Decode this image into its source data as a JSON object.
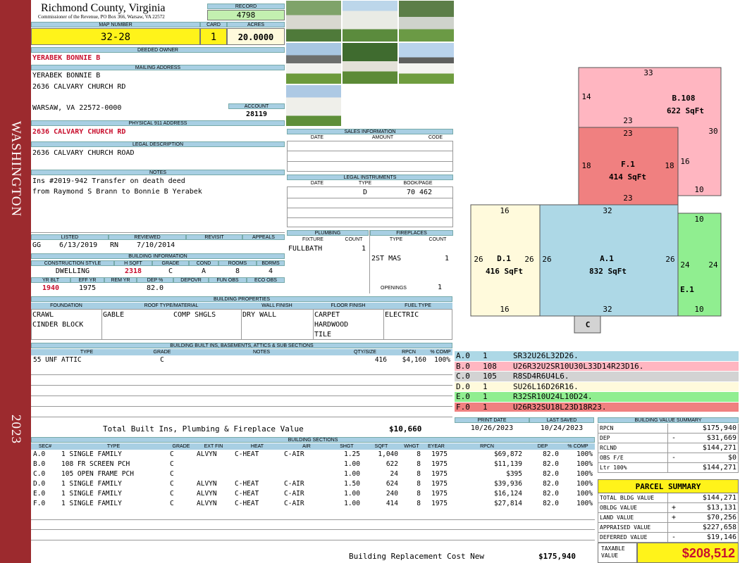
{
  "side": {
    "district": "WASHINGTON",
    "year": "2023"
  },
  "header": {
    "county": "Richmond County, Virginia",
    "commissioner": "Commissioner of the Revenue, PO Box 366, Warsaw, VA 22572",
    "record_label": "RECORD",
    "record": "4798"
  },
  "ids": {
    "map_label": "MAP NUMBER",
    "map": "32-28",
    "card_label": "CARD",
    "card": "1",
    "acres_label": "ACRES",
    "acres": "20.0000"
  },
  "owner": {
    "label": "DEEDED OWNER",
    "name": "YERABEK BONNIE B"
  },
  "mailing": {
    "label": "MAILING ADDRESS",
    "line1": "YERABEK BONNIE B",
    "line2": "2636 CALVARY CHURCH RD",
    "line3": "WARSAW, VA 22572-0000"
  },
  "account": {
    "label": "ACCOUNT",
    "value": "28119"
  },
  "physical": {
    "label": "PHYSICAL 911 ADDRESS",
    "value": "2636 CALVARY CHURCH RD"
  },
  "legal": {
    "label": "LEGAL DESCRIPTION",
    "value": "2636 CALVARY CHURCH ROAD"
  },
  "notes": {
    "label": "NOTES",
    "line1": "Ins #2019-942 Transfer on death deed",
    "line2": "from Raymond S Brann to Bonnie B Yerabek"
  },
  "sales": {
    "label": "SALES INFORMATION",
    "cols": [
      "DATE",
      "AMOUNT",
      "CODE"
    ]
  },
  "instruments": {
    "label": "LEGAL INSTRUMENTS",
    "cols": [
      "DATE",
      "TYPE",
      "BOOK/PAGE"
    ],
    "type": "D",
    "bookpage": "70 462"
  },
  "status": {
    "labels": [
      "LISTED",
      "REVIEWED",
      "REVISIT",
      "APPEALS"
    ],
    "listed_by": "GG",
    "listed": "6/13/2019",
    "reviewed_by": "RN",
    "reviewed": "7/10/2014"
  },
  "building_info": {
    "label": "BUILDING INFORMATION",
    "cols": [
      "CONSTRUCTION STYLE",
      "H SQFT",
      "GRADE",
      "COND",
      "ROOMS",
      "BDRMS"
    ],
    "style": "DWELLING",
    "hsqft": "2318",
    "grade": "C",
    "cond": "A",
    "rooms": "8",
    "bdrms": "4",
    "cols2": [
      "YR BLT",
      "EFF YR",
      "REM YR",
      "DEP %",
      "DEPOVR",
      "FUN OBS",
      "ECO OBS"
    ],
    "yrblt": "1940",
    "effyr": "1975",
    "dep": "82.0"
  },
  "plumbing": {
    "label": "PLUMBING",
    "cols": [
      "FIXTURE",
      "COUNT"
    ],
    "fixture": "FULLBATH",
    "count": "1"
  },
  "fireplaces": {
    "label": "FIREPLACES",
    "cols": [
      "TYPE",
      "COUNT"
    ],
    "type": "2ST MAS",
    "count": "1",
    "openings_label": "OPENINGS",
    "openings": "1"
  },
  "properties": {
    "label": "BUILDING PROPERTIES",
    "cols": [
      "FOUNDATION",
      "ROOF TYPE/MATERIAL",
      "WALL FINISH",
      "FLOOR FINISH",
      "FUEL TYPE"
    ],
    "foundation1": "CRAWL",
    "foundation2": "CINDER BLOCK",
    "roof1": "GABLE",
    "roof2": "COMP SHGLS",
    "wall": "DRY WALL",
    "floor1": "CARPET",
    "floor2": "HARDWOOD",
    "floor3": "TILE",
    "fuel": "ELECTRIC"
  },
  "builtins": {
    "label": "BUILDING BUILT INS, BASEMENTS, ATTICS & SUB SECTIONS",
    "cols": [
      "TYPE",
      "GRADE",
      "NOTES",
      "QTY/SIZE",
      "RPCN",
      "% COMP"
    ],
    "rows": [
      [
        "55 UNF ATTIC",
        "C",
        "",
        "416",
        "$4,160",
        "100%"
      ]
    ],
    "total_label": "Total Built Ins, Plumbing & Fireplace Value",
    "total": "$10,660"
  },
  "dates": {
    "print_label": "PRINT DATE",
    "print": "10/26/2023",
    "saved_label": "LAST SAVED",
    "saved": "10/24/2023"
  },
  "sections": {
    "label": "BUILDING SECTIONS",
    "cols": [
      "SEC#",
      "TYPE",
      "GRADE",
      "EXT FIN",
      "HEAT",
      "AIR",
      "SHGT",
      "SQFT",
      "WHGT",
      "EYEAR",
      "RPCN",
      "DEP",
      "% COMP"
    ],
    "rows": [
      [
        "A.0",
        "1 SINGLE FAMILY",
        "C",
        "ALVYN",
        "C-HEAT",
        "C-AIR",
        "1.25",
        "1,040",
        "8",
        "1975",
        "$69,872",
        "82.0",
        "100%"
      ],
      [
        "B.0",
        "108 FR SCREEN PCH",
        "C",
        "",
        "",
        "",
        "1.00",
        "622",
        "8",
        "1975",
        "$11,139",
        "82.0",
        "100%"
      ],
      [
        "C.0",
        "105 OPEN FRAME PCH",
        "C",
        "",
        "",
        "",
        "1.00",
        "24",
        "8",
        "1975",
        "$395",
        "82.0",
        "100%"
      ],
      [
        "D.0",
        "1 SINGLE FAMILY",
        "C",
        "ALVYN",
        "C-HEAT",
        "C-AIR",
        "1.50",
        "624",
        "8",
        "1975",
        "$39,936",
        "82.0",
        "100%"
      ],
      [
        "E.0",
        "1 SINGLE FAMILY",
        "C",
        "ALVYN",
        "C-HEAT",
        "C-AIR",
        "1.00",
        "240",
        "8",
        "1975",
        "$16,124",
        "82.0",
        "100%"
      ],
      [
        "F.0",
        "1 SINGLE FAMILY",
        "C",
        "ALVYN",
        "C-HEAT",
        "C-AIR",
        "1.00",
        "414",
        "8",
        "1975",
        "$27,814",
        "82.0",
        "100%"
      ]
    ],
    "total_label": "Building Replacement Cost New",
    "total": "$175,940"
  },
  "legend": [
    {
      "sec": "A.0",
      "code": "1",
      "desc": "SR32U26L32D26.",
      "color": "#add8e6"
    },
    {
      "sec": "B.0",
      "code": "108",
      "desc": "U26R32U2SR10U30L33D14R23D16.",
      "color": "#ffb6c1"
    },
    {
      "sec": "C.0",
      "code": "105",
      "desc": "R8SD4R6U4L6.",
      "color": "#d3d3d3"
    },
    {
      "sec": "D.0",
      "code": "1",
      "desc": "SU26L16D26R16.",
      "color": "#fffadc"
    },
    {
      "sec": "E.0",
      "code": "1",
      "desc": "R32SR10U24L10D24.",
      "color": "#90ee90"
    },
    {
      "sec": "F.0",
      "code": "1",
      "desc": "U26R32SU18L23D18R23.",
      "color": "#f08080"
    }
  ],
  "sketch": {
    "B": {
      "name": "B.108",
      "area": "622 SqFt",
      "d_top": "33",
      "d_right": "30",
      "d_left": "14",
      "d_inner_r": "16",
      "d_inner_b": "10",
      "d_inner_t": "23"
    },
    "F": {
      "name": "F.1",
      "area": "414 SqFt",
      "d_top": "23",
      "d_left": "18",
      "d_right": "18",
      "d_bottom": "23"
    },
    "A": {
      "name": "A.1",
      "area": "832 SqFt",
      "d_top": "32",
      "d_bottom": "32",
      "d_left": "26",
      "d_right": "26"
    },
    "D": {
      "name": "D.1",
      "area": "416 SqFt",
      "d_top": "16",
      "d_bottom": "16",
      "d_left": "26",
      "d_right": "26"
    },
    "E": {
      "name": "E.1",
      "d_top": "10",
      "d_bottom": "10",
      "d_left": "24",
      "d_right": "24"
    },
    "C": {
      "name": "C"
    }
  },
  "valuesum": {
    "label": "BUILDING VALUE SUMMARY",
    "rows": [
      [
        "RPCN",
        "",
        "$175,940"
      ],
      [
        "DEP",
        "-",
        "$31,669"
      ],
      [
        "RCLND",
        "",
        "$144,271"
      ],
      [
        "OBS F/E",
        "-",
        "$0"
      ],
      [
        "Ltr 100%",
        "",
        "$144,271"
      ]
    ]
  },
  "parcel": {
    "label": "PARCEL SUMMARY",
    "rows": [
      [
        "TOTAL BLDG VALUE",
        "",
        "$144,271"
      ],
      [
        "OBLDG VALUE",
        "+",
        "$13,131"
      ],
      [
        "LAND VALUE",
        "+",
        "$70,256"
      ],
      [
        "APPRAISED VALUE",
        "",
        "$227,658"
      ],
      [
        "DEFERRED VALUE",
        "-",
        "$19,146"
      ]
    ],
    "taxable_label1": "TAXABLE",
    "taxable_label2": "VALUE",
    "taxable": "$208,512"
  }
}
